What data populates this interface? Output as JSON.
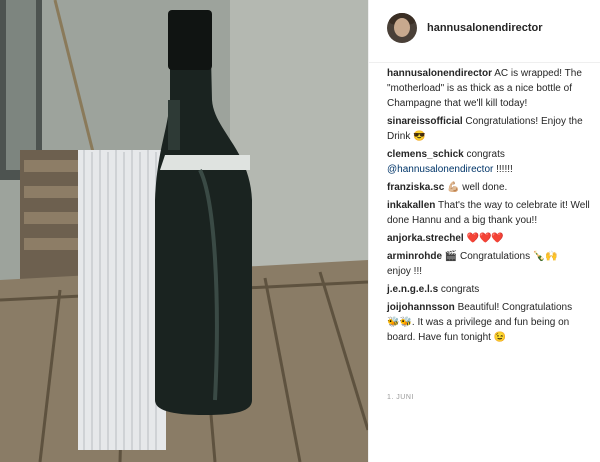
{
  "post": {
    "username": "hannusalonendirector",
    "date": "1. JUNI"
  },
  "comments": [
    {
      "user": "hannusalonendirector",
      "text": "AC is wrapped! The \"motherload\" is as thick as a nice bottle of Champagne that we'll kill today!"
    },
    {
      "user": "sinareissofficial",
      "text": "Congratulations! Enjoy the Drink",
      "emoji": "😎"
    },
    {
      "user": "clemens_schick",
      "text": "congrats",
      "mention": "@hannusalonendirector",
      "tail": " !!!!!!"
    },
    {
      "user": "franziska.sc",
      "emoji": "💪🏼",
      "text": " well done."
    },
    {
      "user": "inkakallen",
      "text": "That's the way to celebrate it! Well done Hannu and a big thank you!!"
    },
    {
      "user": "anjorka.strechel",
      "emoji": "❤️❤️❤️"
    },
    {
      "user": "arminrohde",
      "emoji": "🎬",
      "text": " Congratulations ",
      "emoji2": "🍾🙌",
      "tail": " enjoy !!!"
    },
    {
      "user": "j.e.n.g.e.l.s",
      "text": "congrats"
    },
    {
      "user": "joijohannsson",
      "text": "Beautiful! Congratulations",
      "emoji": "🐝🐝",
      "tail": ". It was a privilege and fun being on board. Have fun tonight ",
      "emoji2": "😉"
    }
  ],
  "icons": {
    "avatar": "profile-avatar"
  }
}
